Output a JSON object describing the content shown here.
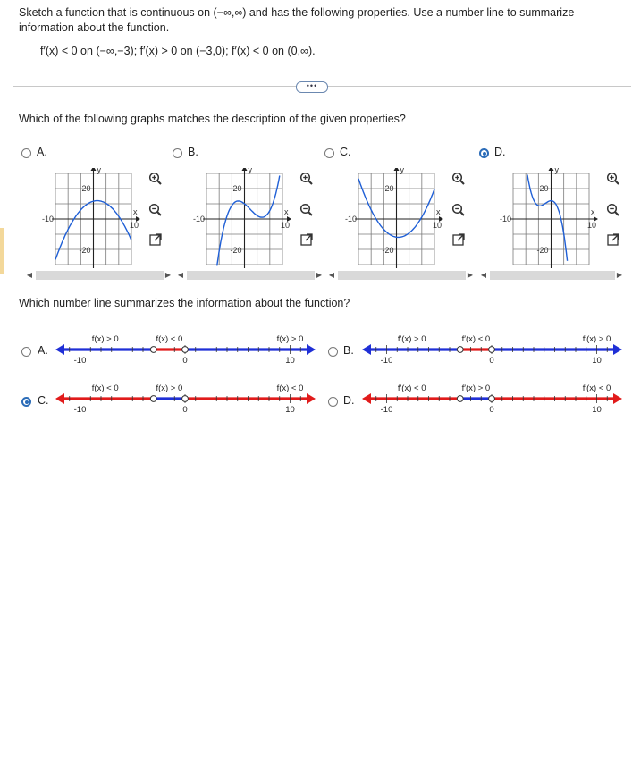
{
  "question": {
    "prompt": "Sketch a function that is continuous on (−∞,∞) and has the following properties. Use a number line to summarize information about the function.",
    "formula": "f′(x) < 0 on (−∞,−3); f′(x) > 0 on (−3,0); f′(x) < 0 on (0,∞).",
    "more_label": "•••",
    "graph_question": "Which of the following graphs matches the description of the given properties?",
    "numberline_question": "Which number line summarizes the information about the function?"
  },
  "graph_options": [
    {
      "label": "A.",
      "selected": false,
      "y_top": "20",
      "y_bottom": "-20",
      "x_left": "-10",
      "x_right": "10",
      "x_axis": "x",
      "y_axis": "y"
    },
    {
      "label": "B.",
      "selected": false,
      "y_top": "20",
      "y_bottom": "-20",
      "x_left": "-10",
      "x_right": "10",
      "x_axis": "x",
      "y_axis": "y"
    },
    {
      "label": "C.",
      "selected": false,
      "y_top": "20",
      "y_bottom": "-20",
      "x_left": "-10",
      "x_right": "10",
      "x_axis": "x",
      "y_axis": "y"
    },
    {
      "label": "D.",
      "selected": true,
      "y_top": "20",
      "y_bottom": "-20",
      "x_left": "-10",
      "x_right": "10",
      "x_axis": "x",
      "y_axis": "y"
    }
  ],
  "numberline_options": [
    {
      "label": "A.",
      "selected": false,
      "left_text": "f(x) > 0",
      "mid_text": "f(x) < 0",
      "right_text": "f(x) > 0",
      "tick_left": "-10",
      "tick_mid": "0",
      "tick_right": "10",
      "colors": [
        "blue",
        "red",
        "blue"
      ]
    },
    {
      "label": "B.",
      "selected": false,
      "left_text": "f′(x) > 0",
      "mid_text": "f′(x) < 0",
      "right_text": "f′(x) > 0",
      "tick_left": "-10",
      "tick_mid": "0",
      "tick_right": "10",
      "colors": [
        "blue",
        "red",
        "blue"
      ]
    },
    {
      "label": "C.",
      "selected": true,
      "left_text": "f(x) < 0",
      "mid_text": "f(x) > 0",
      "right_text": "f(x) < 0",
      "tick_left": "-10",
      "tick_mid": "0",
      "tick_right": "10",
      "colors": [
        "red",
        "blue",
        "red"
      ]
    },
    {
      "label": "D.",
      "selected": false,
      "left_text": "f′(x) < 0",
      "mid_text": "f′(x) > 0",
      "right_text": "f′(x) < 0",
      "tick_left": "-10",
      "tick_mid": "0",
      "tick_right": "10",
      "colors": [
        "red",
        "blue",
        "red"
      ]
    }
  ],
  "icons": [
    "zoom-in-icon",
    "zoom-out-icon",
    "expand-icon"
  ],
  "colors": {
    "accent": "#2b6cb8",
    "blue_line": "#1f2fd6",
    "red_line": "#e11b1b",
    "curve": "#1f5fd6"
  }
}
